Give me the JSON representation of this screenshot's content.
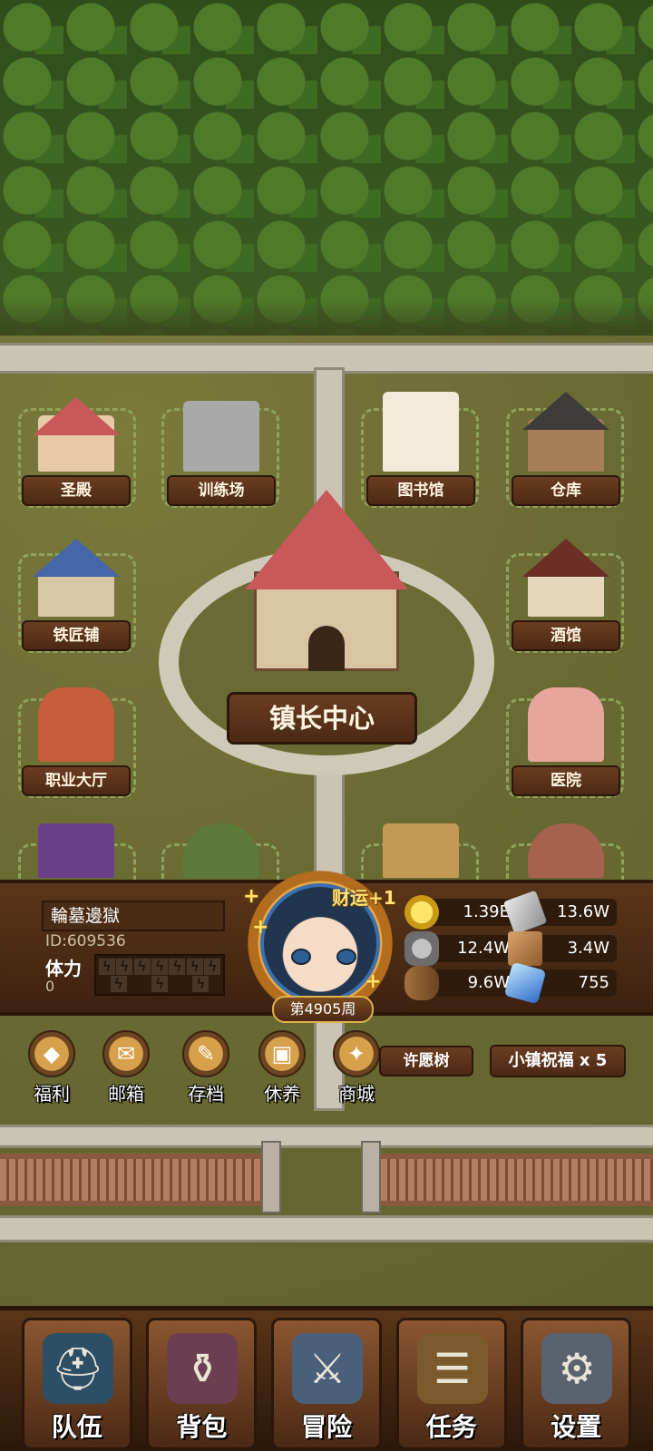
{
  "buildings": {
    "temple": "圣殿",
    "training": "训练场",
    "library": "图书馆",
    "warehouse": "仓库",
    "blacksmith": "铁匠铺",
    "tavern": "酒馆",
    "job_hall": "职业大厅",
    "hospital": "医院",
    "town_center": "镇长中心"
  },
  "player": {
    "name": "輪墓邊獄",
    "id": "ID:609536",
    "stamina_label": "体力",
    "stamina_value": "0",
    "fortune": "财运+1",
    "week": "第4905周"
  },
  "resources": {
    "gold": "1.39E",
    "iron": "13.6W",
    "stone": "12.4W",
    "cloth": "3.4W",
    "wood": "9.6W",
    "crystal": "755"
  },
  "quick_menu": {
    "welfare": "福利",
    "mail": "邮箱",
    "save": "存档",
    "rest": "休养",
    "shop": "商城"
  },
  "wish_tree": "许愿树",
  "town_blessing": "小镇祝福 x 5",
  "nav": {
    "team": "队伍",
    "bag": "背包",
    "adventure": "冒险",
    "quest": "任务",
    "settings": "设置"
  }
}
